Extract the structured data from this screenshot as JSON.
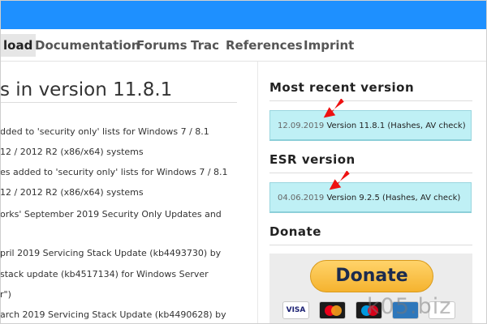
{
  "nav": {
    "items": [
      "load",
      "Documentation",
      "Forums",
      "Trac",
      "References",
      "Imprint"
    ],
    "active_index": 0
  },
  "main": {
    "title": "s in version 11.8.1",
    "lines": [
      "dded to 'security only' lists for Windows 7 / 8.1",
      "12 / 2012 R2 (x86/x64) systems",
      "es added to 'security only' lists for Windows 7 / 8.1",
      "12 / 2012 R2 (x86/x64) systems",
      "orks' September 2019 Security Only Updates and",
      "",
      "pril 2019 Servicing Stack Update (kb4493730) by",
      " stack update (kb4517134) for Windows Server",
      "r\")",
      "arch 2019 Servicing Stack Update (kb4490628) by"
    ]
  },
  "sidebar": {
    "most_recent": {
      "heading": "Most recent version",
      "date": "12.09.2019",
      "version": "Version 11.8.1",
      "extra": "(Hashes, AV check)"
    },
    "esr": {
      "heading": "ESR version",
      "date": "04.06.2019",
      "version": "Version 9.2.5",
      "extra": "(Hashes, AV check)"
    },
    "donate": {
      "heading": "Donate",
      "button_label": "Donate",
      "cards": [
        "VISA",
        "MasterCard",
        "Maestro",
        "Amex",
        "Discover"
      ]
    }
  },
  "watermark": "k05.biz",
  "colors": {
    "topbar": "#1e90ff",
    "version_box": "#bff0f5",
    "arrow": "#ee1111",
    "donate_button": "#f5b32f"
  }
}
